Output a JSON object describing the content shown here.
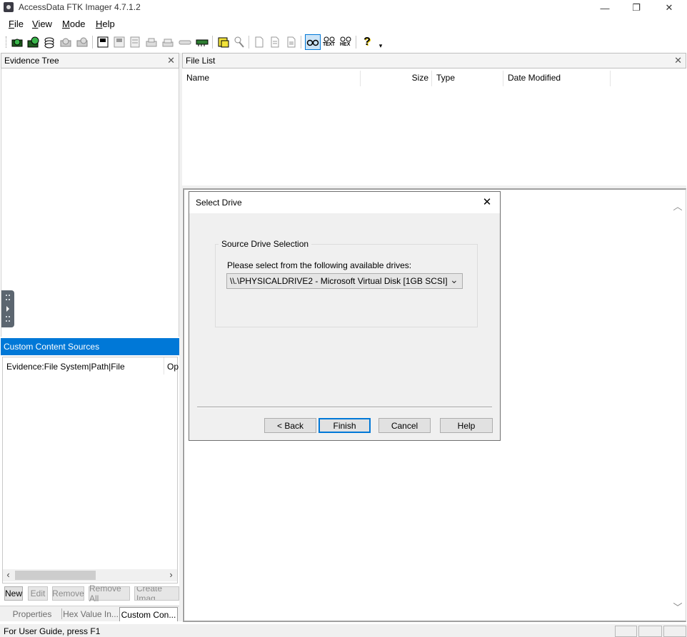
{
  "window": {
    "title": "AccessData FTK Imager 4.7.1.2",
    "controls": {
      "minimize": "—",
      "restore": "❐",
      "close": "✕"
    }
  },
  "menu": [
    {
      "label": "File",
      "mnemonic": "F"
    },
    {
      "label": "View",
      "mnemonic": "V"
    },
    {
      "label": "Mode",
      "mnemonic": "M"
    },
    {
      "label": "Help",
      "mnemonic": "H"
    }
  ],
  "toolbar": {
    "icons": [
      "add-evidence-icon",
      "add-all-evidence-icon",
      "image-mounting-icon",
      "remove-evidence-icon",
      "remove-all-evidence-icon",
      "create-disk-image-icon",
      "export-disk-image-icon",
      "export-logical-image-icon",
      "add-to-custom-content-icon",
      "create-custom-image-icon",
      "decrypt-ad1-icon",
      "detect-efs-icon",
      "capture-memory-icon",
      "obtain-protected-files-icon",
      "verify-drive-icon",
      "export-files-icon",
      "export-hash-list-icon",
      "export-directory-listing-icon",
      "auto-view-icon",
      "text-view-icon",
      "hex-view-icon",
      "help-icon",
      "toolbar-options-icon"
    ],
    "text_icon_label": "TEXT",
    "hex_icon_label": "HEX",
    "help_glyph": "?",
    "more_glyph": "▾"
  },
  "evidence_tree": {
    "title": "Evidence Tree",
    "close": "✕"
  },
  "file_list": {
    "title": "File List",
    "close": "✕",
    "columns": [
      "Name",
      "Size",
      "Type",
      "Date Modified"
    ]
  },
  "custom_content": {
    "title": "Custom Content Sources",
    "columns": [
      "Evidence:File System|Path|File",
      "Op"
    ],
    "scroll_left": "‹",
    "scroll_right": "›",
    "buttons": [
      {
        "label": "New",
        "enabled": true
      },
      {
        "label": "Edit",
        "enabled": false
      },
      {
        "label": "Remove",
        "enabled": false
      },
      {
        "label": "Remove All",
        "enabled": false
      },
      {
        "label": "Create Imag",
        "enabled": false
      }
    ]
  },
  "bottom_tabs": [
    "Properties",
    "Hex Value In...",
    "Custom Con..."
  ],
  "viewer": {
    "scroll_up": "︿",
    "scroll_down": "﹀"
  },
  "dialog": {
    "title": "Select Drive",
    "close": "✕",
    "group_label": "Source Drive Selection",
    "prompt": "Please select from the following available drives:",
    "selected_drive": "\\\\.\\PHYSICALDRIVE2 - Microsoft Virtual Disk [1GB SCSI]",
    "dropdown_arrow": "⌄",
    "buttons": {
      "back": "< Back",
      "finish": "Finish",
      "cancel": "Cancel",
      "help": "Help"
    }
  },
  "status_bar": {
    "text": "For User Guide, press F1"
  },
  "colors": {
    "selection_blue": "#0078d7",
    "header_gray": "#f4f4f4",
    "dialog_bg": "#f0f0f0"
  }
}
